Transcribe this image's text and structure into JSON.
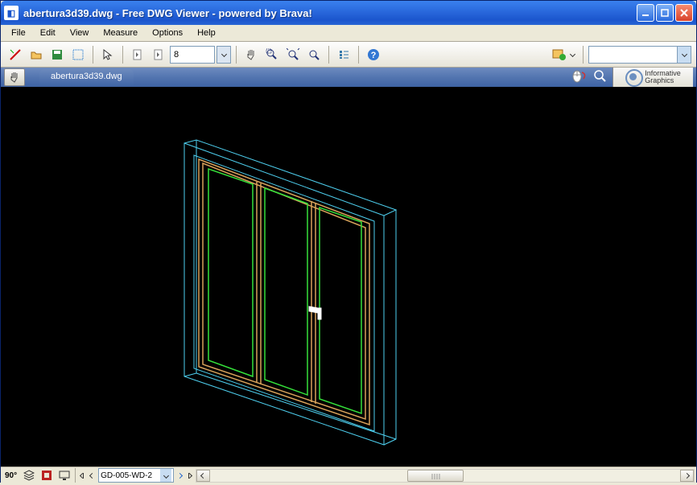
{
  "window": {
    "title": "abertura3d39.dwg - Free DWG Viewer - powered by Brava!"
  },
  "menubar": {
    "items": [
      "File",
      "Edit",
      "View",
      "Measure",
      "Options",
      "Help"
    ]
  },
  "toolbar": {
    "page_value": "8",
    "right_combo_value": ""
  },
  "tabbar": {
    "active_tab": "abertura3d39.dwg",
    "brand_line1": "Informative",
    "brand_line2": "Graphics"
  },
  "statusbar": {
    "angle_label": "90°",
    "sheet_value": "GD-005-WD-2"
  }
}
